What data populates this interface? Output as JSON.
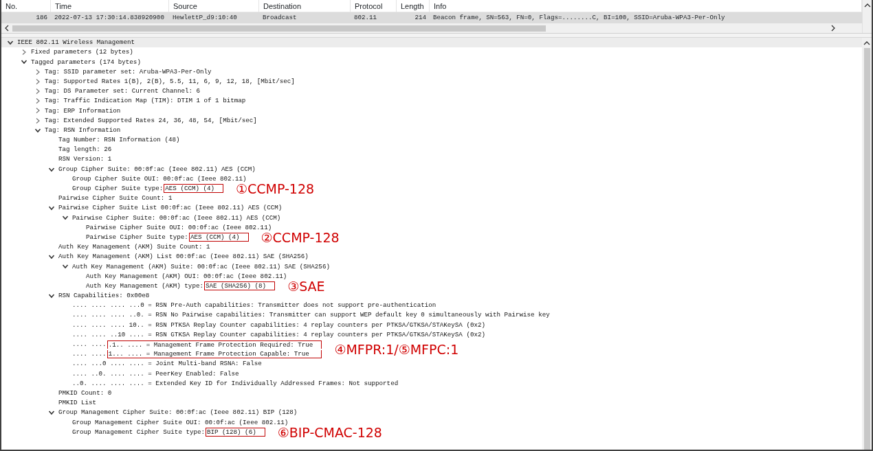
{
  "packet_list": {
    "columns": [
      "No.",
      "Time",
      "Source",
      "Destination",
      "Protocol",
      "Length",
      "Info"
    ],
    "rows": [
      {
        "no": "186",
        "time": "2022-07-13 17:30:14.838920900",
        "source": "HewlettP_d9:10:40",
        "destination": "Broadcast",
        "protocol": "802.11",
        "length": "214",
        "info": "Beacon frame, SN=563, FN=0, Flags=........C, BI=100, SSID=Aruba-WPA3-Per-Only",
        "selected": true
      }
    ]
  },
  "details": {
    "tree": [
      {
        "text": "IEEE 802.11 Wireless Management",
        "expanded": true,
        "children": [
          {
            "text": "Fixed parameters (12 bytes)",
            "expanded": false
          },
          {
            "text": "Tagged parameters (174 bytes)",
            "expanded": true,
            "children": [
              {
                "text": "Tag: SSID parameter set: Aruba-WPA3-Per-Only",
                "expanded": false
              },
              {
                "text": "Tag: Supported Rates 1(B), 2(B), 5.5, 11, 6, 9, 12, 18, [Mbit/sec]",
                "expanded": false
              },
              {
                "text": "Tag: DS Parameter set: Current Channel: 6",
                "expanded": false
              },
              {
                "text": "Tag: Traffic Indication Map (TIM): DTIM 1 of 1 bitmap",
                "expanded": false
              },
              {
                "text": "Tag: ERP Information",
                "expanded": false
              },
              {
                "text": "Tag: Extended Supported Rates 24, 36, 48, 54, [Mbit/sec]",
                "expanded": false
              },
              {
                "text": "Tag: RSN Information",
                "expanded": true,
                "children": [
                  {
                    "text": "Tag Number: RSN Information (48)"
                  },
                  {
                    "text": "Tag length: 26"
                  },
                  {
                    "text": "RSN Version: 1"
                  },
                  {
                    "text": "Group Cipher Suite: 00:0f:ac (Ieee 802.11) AES (CCM)",
                    "expanded": true,
                    "children": [
                      {
                        "text": "Group Cipher Suite OUI: 00:0f:ac (Ieee 802.11)"
                      },
                      {
                        "text": "Group Cipher Suite type:",
                        "value": "AES (CCM) (4)",
                        "callout": "①CCMP-128"
                      }
                    ]
                  },
                  {
                    "text": "Pairwise Cipher Suite Count: 1"
                  },
                  {
                    "text": "Pairwise Cipher Suite List 00:0f:ac (Ieee 802.11) AES (CCM)",
                    "expanded": true,
                    "children": [
                      {
                        "text": "Pairwise Cipher Suite: 00:0f:ac (Ieee 802.11) AES (CCM)",
                        "expanded": true,
                        "children": [
                          {
                            "text": "Pairwise Cipher Suite OUI: 00:0f:ac (Ieee 802.11)"
                          },
                          {
                            "text": "Pairwise Cipher Suite type:",
                            "value": "AES (CCM) (4)",
                            "callout": "②CCMP-128"
                          }
                        ]
                      }
                    ]
                  },
                  {
                    "text": "Auth Key Management (AKM) Suite Count: 1"
                  },
                  {
                    "text": "Auth Key Management (AKM) List 00:0f:ac (Ieee 802.11) SAE (SHA256)",
                    "expanded": true,
                    "children": [
                      {
                        "text": "Auth Key Management (AKM) Suite: 00:0f:ac (Ieee 802.11) SAE (SHA256)",
                        "expanded": true,
                        "children": [
                          {
                            "text": "Auth Key Management (AKM) OUI: 00:0f:ac (Ieee 802.11)"
                          },
                          {
                            "text": "Auth Key Management (AKM) type:",
                            "value": "SAE (SHA256) (8)",
                            "callout": "③SAE"
                          }
                        ]
                      }
                    ]
                  },
                  {
                    "text": "RSN Capabilities: 0x00e8",
                    "expanded": true,
                    "children": [
                      {
                        "text": ".... .... .... ...0 = RSN Pre-Auth capabilities: Transmitter does not support pre-authentication"
                      },
                      {
                        "text": ".... .... .... ..0. = RSN No Pairwise capabilities: Transmitter can support WEP default key 0 simultaneously with Pairwise key"
                      },
                      {
                        "text": ".... .... .... 10.. = RSN PTKSA Replay Counter capabilities: 4 replay counters per PTKSA/GTKSA/STAKeySA (0x2)"
                      },
                      {
                        "text": ".... .... ..10 .... = RSN GTKSA Replay Counter capabilities: 4 replay counters per PTKSA/GTKSA/STAKeySA (0x2)"
                      },
                      {
                        "text": ".... ....",
                        "value": ".1.. .... = Management Frame Protection Required: True",
                        "callout": "④MFPR:1/⑤MFPC:1"
                      },
                      {
                        "text": ".... ....",
                        "value": "1... .... = Management Frame Protection Capable: True"
                      },
                      {
                        "text": ".... ...0 .... .... = Joint Multi-band RSNA: False"
                      },
                      {
                        "text": ".... ..0. .... .... = PeerKey Enabled: False"
                      },
                      {
                        "text": "..0. .... .... .... = Extended Key ID for Individually Addressed Frames: Not supported"
                      }
                    ]
                  },
                  {
                    "text": "PMKID Count: 0"
                  },
                  {
                    "text": "PMKID List"
                  },
                  {
                    "text": "Group Management Cipher Suite: 00:0f:ac (Ieee 802.11) BIP (128)",
                    "expanded": true,
                    "children": [
                      {
                        "text": "Group Management Cipher Suite OUI: 00:0f:ac (Ieee 802.11)"
                      },
                      {
                        "text": "Group Management Cipher Suite type:",
                        "value": "BIP (128) (6)",
                        "callout": "⑥BIP-CMAC-128"
                      }
                    ]
                  }
                ]
              }
            ]
          }
        ]
      }
    ]
  }
}
